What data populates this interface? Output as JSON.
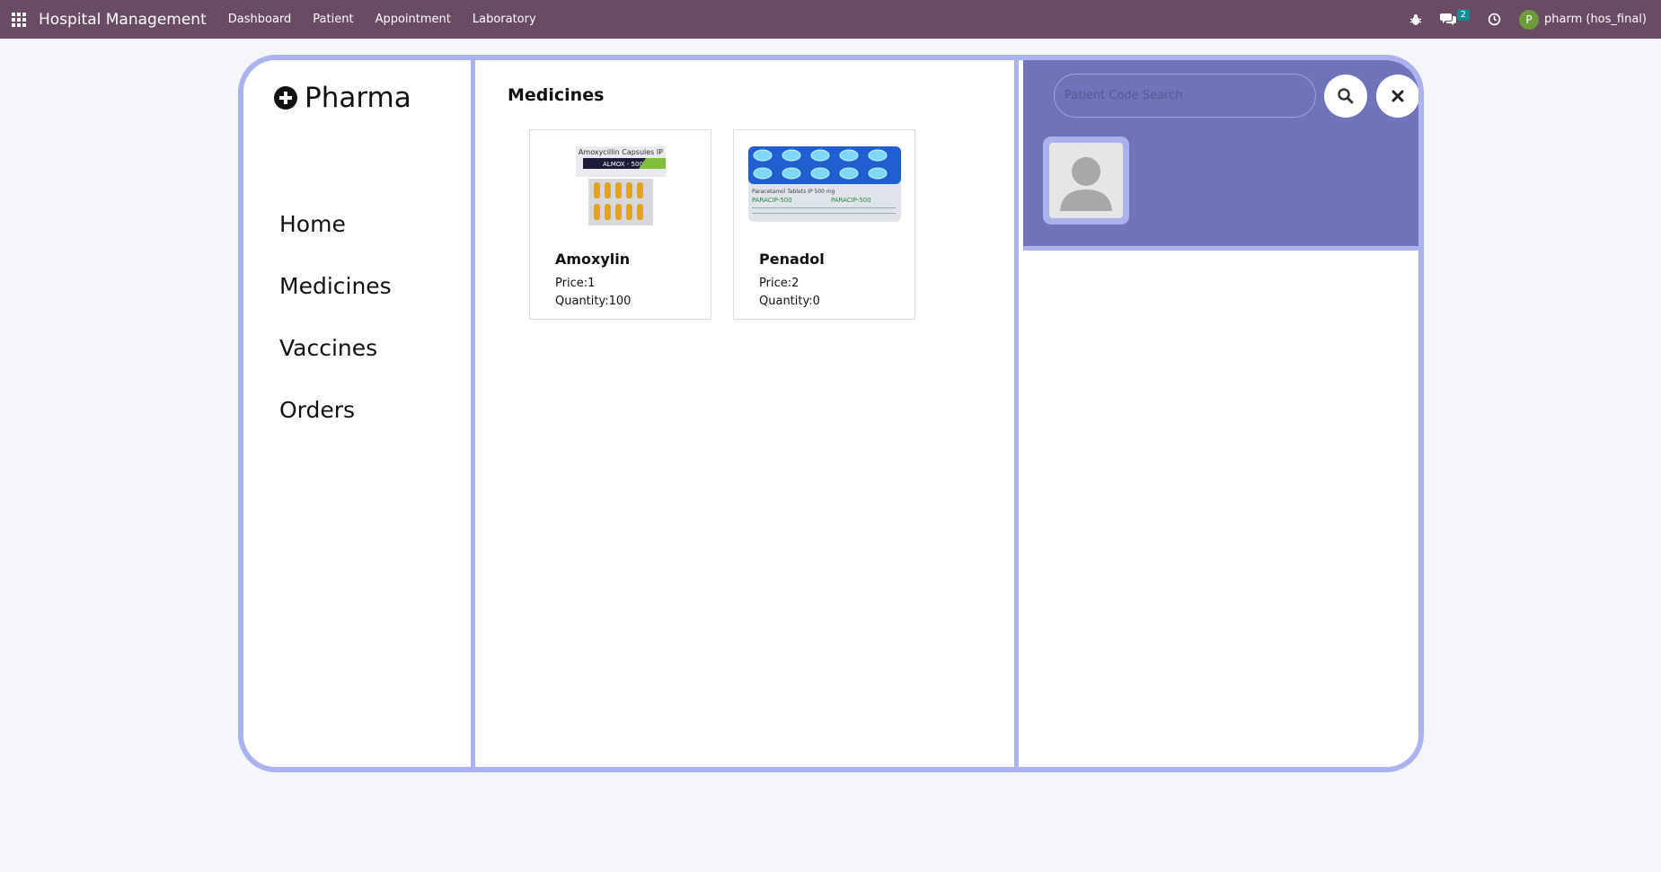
{
  "navbar": {
    "brand": "Hospital Management",
    "menu": [
      "Dashboard",
      "Patient",
      "Appointment",
      "Laboratory"
    ],
    "messages_count": "2",
    "user_initial": "P",
    "user_name": "pharm (hos_final)",
    "color": "#6a4b64"
  },
  "sidebar": {
    "logo_text": "Pharma",
    "items": [
      "Home",
      "Medicines",
      "Vaccines",
      "Orders"
    ]
  },
  "content": {
    "title": "Medicines",
    "cards": [
      {
        "name": "Amoxylin",
        "price": "Price:1",
        "quantity": "Quantity:100",
        "thumb_texts": [
          "Amoxycillin Capsules IP",
          "ALMOX - 500"
        ]
      },
      {
        "name": "Penadol",
        "price": "Price:2",
        "quantity": "Quantity:0",
        "thumb_texts": [
          "Paracetamol Tablets IP 500 mg",
          "PARACIP-500",
          "PARACIP-500"
        ]
      }
    ]
  },
  "patient_panel": {
    "search_placeholder": "Patient Code Search",
    "header_color": "#6f74ba",
    "border_color": "#aab3ee"
  }
}
